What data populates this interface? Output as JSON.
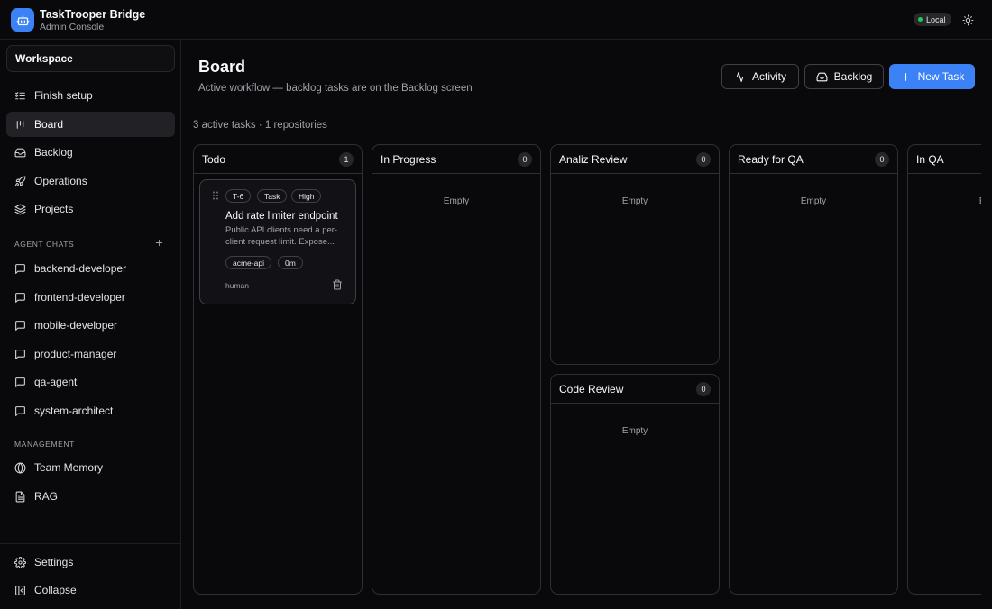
{
  "app": {
    "title": "TaskTrooper Bridge",
    "subtitle": "Admin Console",
    "env_label": "Local",
    "accent": "#3b82f6"
  },
  "sidebar": {
    "workspace_label": "Workspace",
    "items": [
      {
        "label": "Finish setup",
        "icon": "checklist-icon"
      },
      {
        "label": "Board",
        "icon": "kanban-icon",
        "active": true
      },
      {
        "label": "Backlog",
        "icon": "inbox-icon"
      },
      {
        "label": "Operations",
        "icon": "rocket-icon"
      },
      {
        "label": "Projects",
        "icon": "layers-icon"
      }
    ],
    "agent_chats_label": "AGENT CHATS",
    "agent_chats": [
      {
        "label": "backend-developer",
        "icon": "message-icon"
      },
      {
        "label": "frontend-developer",
        "icon": "message-icon"
      },
      {
        "label": "mobile-developer",
        "icon": "message-icon"
      },
      {
        "label": "product-manager",
        "icon": "message-icon"
      },
      {
        "label": "qa-agent",
        "icon": "message-icon"
      },
      {
        "label": "system-architect",
        "icon": "message-icon"
      }
    ],
    "management_label": "MANAGEMENT",
    "management": [
      {
        "label": "Team Memory",
        "icon": "globe-icon"
      },
      {
        "label": "RAG",
        "icon": "file-icon"
      }
    ],
    "footer": [
      {
        "label": "Settings",
        "icon": "gear-icon"
      },
      {
        "label": "Collapse",
        "icon": "panel-collapse-icon"
      }
    ]
  },
  "main": {
    "title": "Board",
    "subtitle": "Active workflow — backlog tasks are on the Backlog screen",
    "actions": {
      "activity": "Activity",
      "backlog": "Backlog",
      "new_task": "New Task"
    },
    "summary": "3 active tasks · 1 repositories",
    "empty_label": "Empty",
    "columns": [
      {
        "name": "Todo",
        "count": "1"
      },
      {
        "name": "In Progress",
        "count": "0"
      },
      {
        "name": "Analiz Review",
        "count": "0"
      },
      {
        "name": "Code Review",
        "count": "0"
      },
      {
        "name": "Ready for QA",
        "count": "0"
      },
      {
        "name": "In QA",
        "count": ""
      }
    ],
    "task": {
      "id": "T-6",
      "type": "Task",
      "priority": "High",
      "title": "Add rate limiter endpoint",
      "description": "Public API clients need a per-client request limit. Expose...",
      "repo": "acme-api",
      "elapsed": "0m",
      "author": "human"
    }
  }
}
